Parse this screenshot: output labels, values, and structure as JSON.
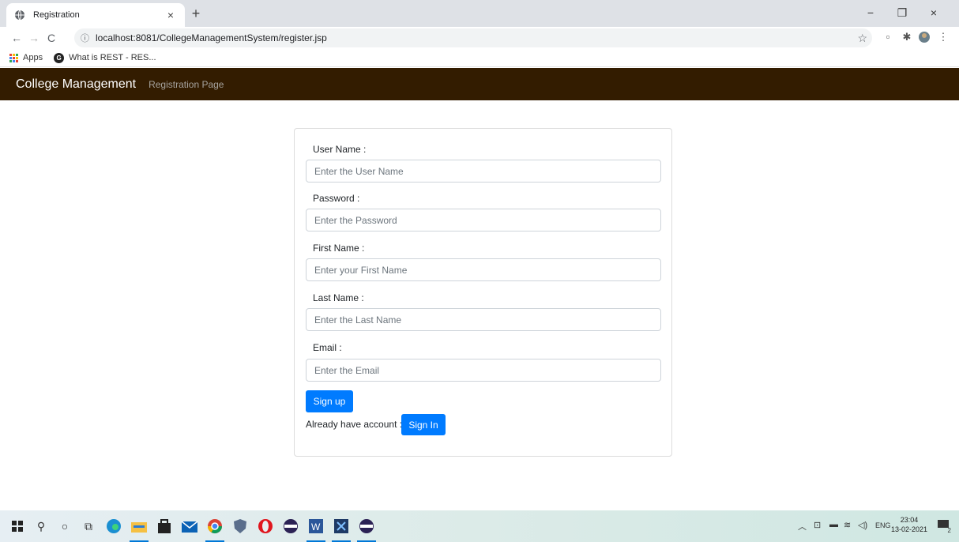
{
  "browser": {
    "tab_title": "Registration",
    "tab_close": "×",
    "new_tab": "+",
    "url": "localhost:8081/CollegeManagementSystem/register.jsp",
    "bookmarks": [
      {
        "label": "Apps",
        "icon": "apps-grid-icon"
      },
      {
        "label": "What is REST - RES...",
        "icon": "g-logo-icon"
      }
    ],
    "window_controls": [
      "−",
      "❐",
      "×"
    ]
  },
  "app": {
    "brand": "College Management",
    "nav_link": "Registration Page",
    "nav_bg": "#331c00"
  },
  "form": {
    "fields": [
      {
        "label": "User Name :",
        "placeholder": "Enter the User Name"
      },
      {
        "label": "Password :",
        "placeholder": "Enter the Password"
      },
      {
        "label": "First Name :",
        "placeholder": "Enter your First Name"
      },
      {
        "label": "Last Name :",
        "placeholder": "Enter the Last Name"
      },
      {
        "label": "Email :",
        "placeholder": "Enter the Email"
      }
    ],
    "signup_label": "Sign up",
    "already_text": "Already have account :",
    "signin_label": "Sign In",
    "accent": "#007bff"
  },
  "taskbar": {
    "time": "23:04",
    "date": "13-02-2021",
    "lang": "ENG",
    "notif_count": "2"
  }
}
